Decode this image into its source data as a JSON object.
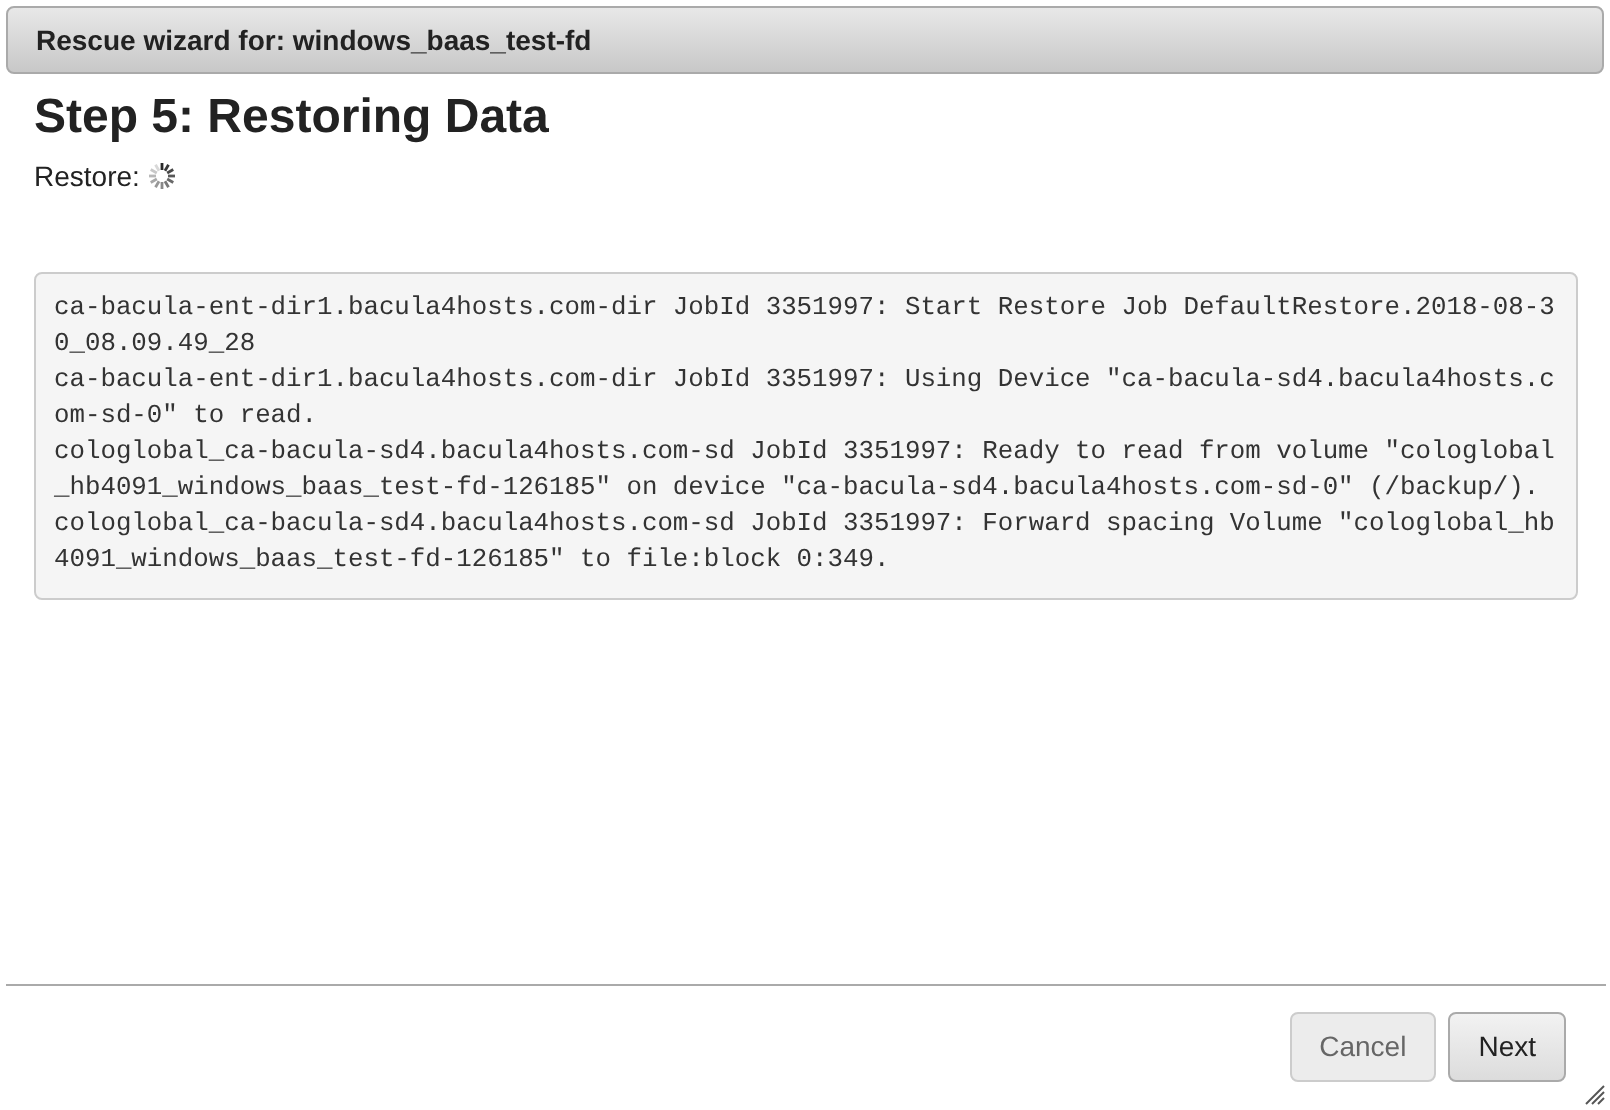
{
  "dialog": {
    "title": "Rescue wizard for: windows_baas_test-fd"
  },
  "step_title": "Step 5: Restoring Data",
  "status_label": "Restore:",
  "log": [
    "ca-bacula-ent-dir1.bacula4hosts.com-dir JobId 3351997: Start Restore Job DefaultRestore.2018-08-30_08.09.49_28",
    "ca-bacula-ent-dir1.bacula4hosts.com-dir JobId 3351997: Using Device \"ca-bacula-sd4.bacula4hosts.com-sd-0\" to read.",
    "cologlobal_ca-bacula-sd4.bacula4hosts.com-sd JobId 3351997: Ready to read from volume \"cologlobal_hb4091_windows_baas_test-fd-126185\" on device \"ca-bacula-sd4.bacula4hosts.com-sd-0\" (/backup/).",
    "cologlobal_ca-bacula-sd4.bacula4hosts.com-sd JobId 3351997: Forward spacing Volume \"cologlobal_hb4091_windows_baas_test-fd-126185\" to file:block 0:349."
  ],
  "buttons": [
    {
      "label": "Cancel",
      "disabled": true
    },
    {
      "label": "Next",
      "disabled": false
    }
  ]
}
